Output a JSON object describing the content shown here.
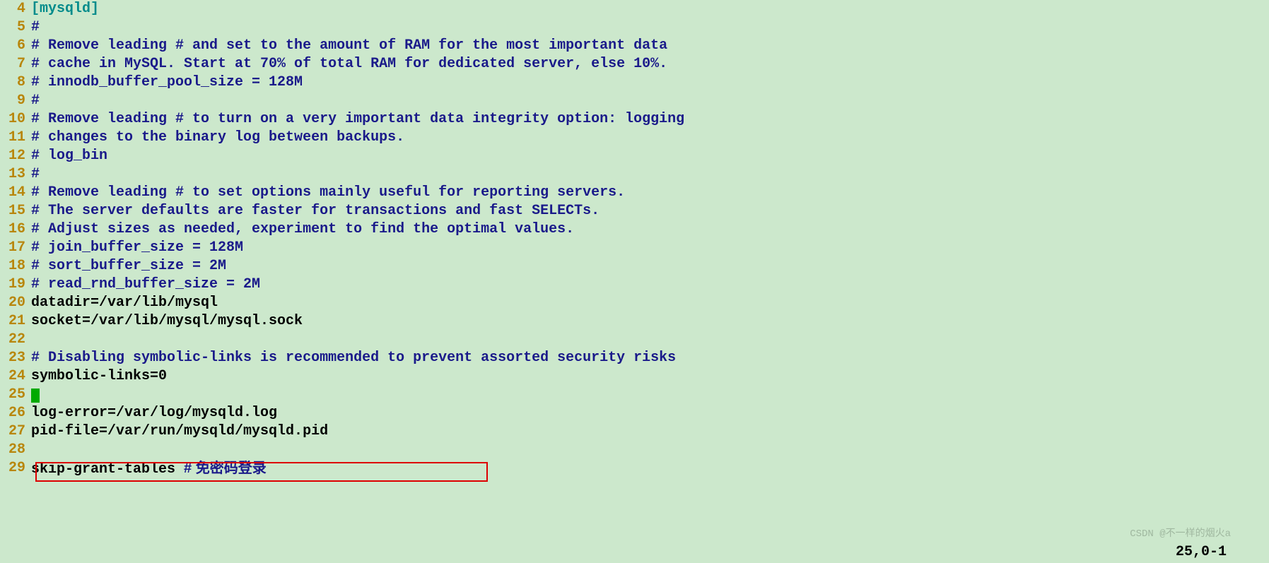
{
  "lines": [
    {
      "num": "4",
      "text": "[mysqld]",
      "class": "section"
    },
    {
      "num": "5",
      "text": "#",
      "class": "content"
    },
    {
      "num": "6",
      "text": "# Remove leading # and set to the amount of RAM for the most important data",
      "class": "content"
    },
    {
      "num": "7",
      "text": "# cache in MySQL. Start at 70% of total RAM for dedicated server, else 10%.",
      "class": "content"
    },
    {
      "num": "8",
      "text": "# innodb_buffer_pool_size = 128M",
      "class": "content"
    },
    {
      "num": "9",
      "text": "#",
      "class": "content"
    },
    {
      "num": "10",
      "text": "# Remove leading # to turn on a very important data integrity option: logging",
      "class": "content"
    },
    {
      "num": "11",
      "text": "# changes to the binary log between backups.",
      "class": "content"
    },
    {
      "num": "12",
      "text": "# log_bin",
      "class": "content"
    },
    {
      "num": "13",
      "text": "#",
      "class": "content"
    },
    {
      "num": "14",
      "text": "# Remove leading # to set options mainly useful for reporting servers.",
      "class": "content"
    },
    {
      "num": "15",
      "text": "# The server defaults are faster for transactions and fast SELECTs.",
      "class": "content"
    },
    {
      "num": "16",
      "text": "# Adjust sizes as needed, experiment to find the optimal values.",
      "class": "content"
    },
    {
      "num": "17",
      "text": "# join_buffer_size = 128M",
      "class": "content"
    },
    {
      "num": "18",
      "text": "# sort_buffer_size = 2M",
      "class": "content"
    },
    {
      "num": "19",
      "text": "# read_rnd_buffer_size = 2M",
      "class": "content"
    },
    {
      "num": "20",
      "text": "datadir=/var/lib/mysql",
      "class": "normal"
    },
    {
      "num": "21",
      "text": "socket=/var/lib/mysql/mysql.sock",
      "class": "normal"
    },
    {
      "num": "22",
      "text": "",
      "class": "normal"
    },
    {
      "num": "23",
      "text": "# Disabling symbolic-links is recommended to prevent assorted security risks",
      "class": "content"
    },
    {
      "num": "24",
      "text": "symbolic-links=0",
      "class": "normal"
    },
    {
      "num": "25",
      "text": "",
      "class": "normal",
      "cursor": true
    },
    {
      "num": "26",
      "text": "log-error=/var/log/mysqld.log",
      "class": "normal"
    },
    {
      "num": "27",
      "text": "pid-file=/var/run/mysqld/mysqld.pid",
      "class": "normal"
    },
    {
      "num": "28",
      "text": "",
      "class": "normal"
    },
    {
      "num": "29",
      "text": "skip-grant-tables ",
      "class": "normal",
      "comment": "# 免密码登录"
    }
  ],
  "watermark": "CSDN @不一样的烟火a",
  "status": "25,0-1"
}
